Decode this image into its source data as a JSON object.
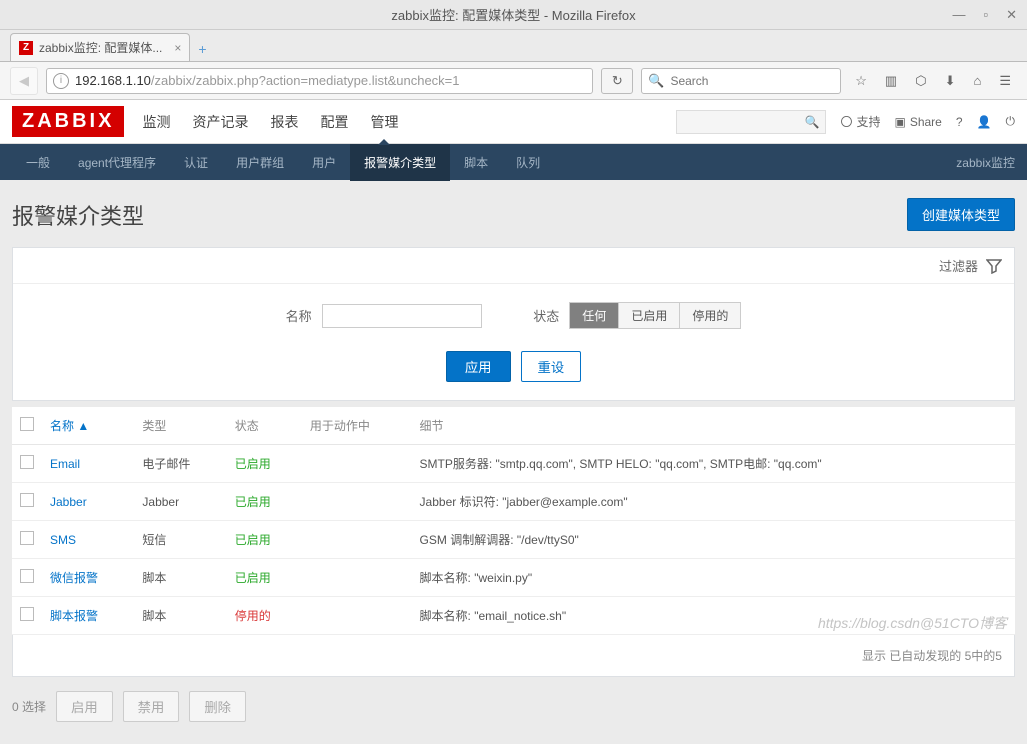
{
  "window": {
    "title": "zabbix监控: 配置媒体类型 - Mozilla Firefox"
  },
  "browser": {
    "tab_title": "zabbix监控: 配置媒体...",
    "new_tab": "+",
    "url_host": "192.168.1.10",
    "url_path": "/zabbix/zabbix.php?action=mediatype.list&uncheck=1",
    "search_placeholder": "Search"
  },
  "zabbix": {
    "logo": "ZABBIX",
    "main_nav": [
      "监测",
      "资产记录",
      "报表",
      "配置",
      "管理"
    ],
    "main_nav_active": "管理",
    "support": "支持",
    "share": "Share",
    "sub_nav": [
      "一般",
      "agent代理程序",
      "认证",
      "用户群组",
      "用户",
      "报警媒介类型",
      "脚本",
      "队列"
    ],
    "sub_nav_active": "报警媒介类型",
    "sub_nav_right": "zabbix监控"
  },
  "page": {
    "title": "报警媒介类型",
    "create_btn": "创建媒体类型",
    "filter_label": "过滤器",
    "filter_name_label": "名称",
    "filter_name_value": "",
    "filter_status_label": "状态",
    "status_options": [
      "任何",
      "已启用",
      "停用的"
    ],
    "status_active": "任何",
    "apply": "应用",
    "reset": "重设"
  },
  "table": {
    "headers": {
      "name": "名称",
      "type": "类型",
      "status": "状态",
      "used_in": "用于动作中",
      "details": "细节"
    },
    "sort_indicator": "▲",
    "rows": [
      {
        "name": "Email",
        "type": "电子邮件",
        "status": "已启用",
        "status_cls": "enabled",
        "details": "SMTP服务器: \"smtp.qq.com\", SMTP HELO: \"qq.com\", SMTP电邮: \"qq.com\""
      },
      {
        "name": "Jabber",
        "type": "Jabber",
        "status": "已启用",
        "status_cls": "enabled",
        "details": "Jabber 标识符: \"jabber@example.com\""
      },
      {
        "name": "SMS",
        "type": "短信",
        "status": "已启用",
        "status_cls": "enabled",
        "details": "GSM 调制解调器: \"/dev/ttyS0\""
      },
      {
        "name": "微信报警",
        "type": "脚本",
        "status": "已启用",
        "status_cls": "enabled",
        "details": "脚本名称: \"weixin.py\""
      },
      {
        "name": "脚本报警",
        "type": "脚本",
        "status": "停用的",
        "status_cls": "disabled",
        "details": "脚本名称: \"email_notice.sh\""
      }
    ],
    "footer": "显示 已自动发现的 5中的5"
  },
  "bulk": {
    "selected": "0 选择",
    "enable": "启用",
    "disable": "禁用",
    "delete": "删除"
  },
  "watermark": "https://blog.csdn@51CTO博客"
}
